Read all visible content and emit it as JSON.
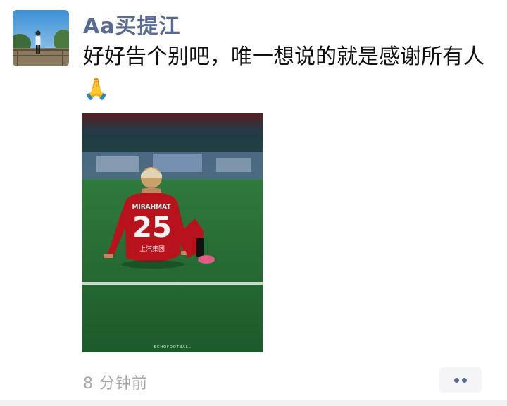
{
  "post": {
    "author": "Aa买提江",
    "text": "好好告个别吧，唯一想说的就是感谢所有人🙏",
    "time": "8 分钟前"
  },
  "photo": {
    "jersey_name": "MIRAHMAT",
    "jersey_number": "25",
    "sponsor_text": "上汽集团",
    "watermark": "ECHOFOOTBALL"
  },
  "colors": {
    "author_link": "#576b95",
    "time_gray": "#a8a8a8",
    "jersey_red": "#b8121c"
  }
}
